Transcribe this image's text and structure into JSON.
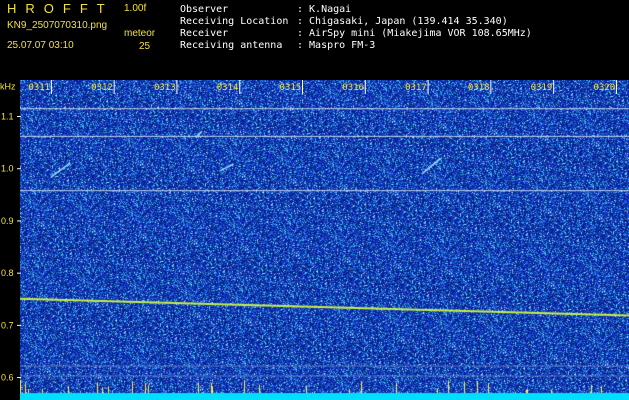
{
  "header": {
    "app_title": "HROFFT",
    "version": "1.00f",
    "filename": "KN9_2507070310.png",
    "mode": "meteor",
    "datetime": "25.07.07 03:10",
    "count": "25",
    "info": [
      {
        "label": "Observer",
        "value": ": K.Nagai"
      },
      {
        "label": "Receiving Location",
        "value": ": Chigasaki, Japan (139.414 35.340)"
      },
      {
        "label": "Receiver",
        "value": ": AirSpy mini (Miakejima VOR 108.65MHz)"
      },
      {
        "label": "Receiving antenna",
        "value": ": Maspro FM-3"
      }
    ]
  },
  "colors": {
    "text_yellow": "#f2e23a",
    "text_white": "#ffffff",
    "background": "#000000",
    "noise_base": "#1a2aa6",
    "signal_line": "#e8f3ff",
    "meteor_echo": "#9fe8ff",
    "sweep_trace": "#c9f04a",
    "baseline": "#00dfff"
  },
  "chart_data": {
    "type": "heatmap",
    "title": "",
    "ylabel": "kHz",
    "xlabel": "",
    "x_ticks": [
      "0311",
      "0312",
      "0313",
      "0314",
      "0315",
      "0316",
      "0317",
      "0318",
      "0319",
      "0320"
    ],
    "x_range_min": [
      10.5,
      20.2
    ],
    "y_ticks": [
      0.6,
      0.7,
      0.8,
      0.9,
      1.0,
      1.1
    ],
    "y_range_khz": [
      0.58,
      1.17
    ],
    "horizontal_lines_khz": [
      1.115,
      1.062,
      0.958,
      0.622,
      0.603
    ],
    "sweep_trace": {
      "start": {
        "min": 10.5,
        "khz": 0.751
      },
      "end": {
        "min": 20.2,
        "khz": 0.719
      }
    },
    "meteor_echoes": [
      {
        "min_start": 11.0,
        "khz_start": 0.985,
        "min_end": 11.3,
        "khz_end": 1.011
      },
      {
        "min_start": 13.7,
        "khz_start": 0.997,
        "min_end": 13.9,
        "khz_end": 1.009
      },
      {
        "min_start": 16.9,
        "khz_start": 0.99,
        "min_end": 17.2,
        "khz_end": 1.02
      },
      {
        "min_start": 13.3,
        "khz_start": 1.06,
        "min_end": 13.4,
        "khz_end": 1.072
      }
    ],
    "grid": true
  }
}
